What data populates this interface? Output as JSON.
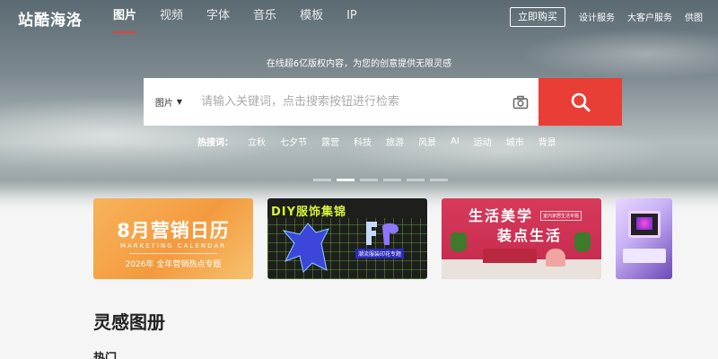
{
  "header": {
    "logo": "站酷海洛",
    "nav": [
      "图片",
      "视频",
      "字体",
      "音乐",
      "模板",
      "IP"
    ],
    "active_nav": 0,
    "buy_label": "立即购买",
    "links": [
      "设计服务",
      "大客户服务",
      "供图"
    ]
  },
  "search": {
    "tagline": "在线超6亿版权内容，为您的创意提供无限灵感",
    "type_label": "图片",
    "placeholder": "请输入关键词，点击搜索按钮进行检索"
  },
  "hot": {
    "label": "热搜词：",
    "items": [
      "立秋",
      "七夕节",
      "露营",
      "科技",
      "旅游",
      "风景",
      "AI",
      "运动",
      "城市",
      "背景"
    ]
  },
  "carousel": {
    "dot_count": 6,
    "active": 1
  },
  "banners": [
    {
      "title": "8月营销日历",
      "sub": "MARKETING CALENDAR",
      "foot": "2026年 全年营销热点专题"
    },
    {
      "title": "DIY服饰集锦",
      "sub": "潮流服装印花专题"
    },
    {
      "title1": "生活美学",
      "title2": "装点生活",
      "tag": "室内家居生活专题"
    },
    {}
  ],
  "sections": {
    "title": "灵感图册",
    "sub": "热门"
  },
  "colors": {
    "accent": "#e93e35"
  }
}
